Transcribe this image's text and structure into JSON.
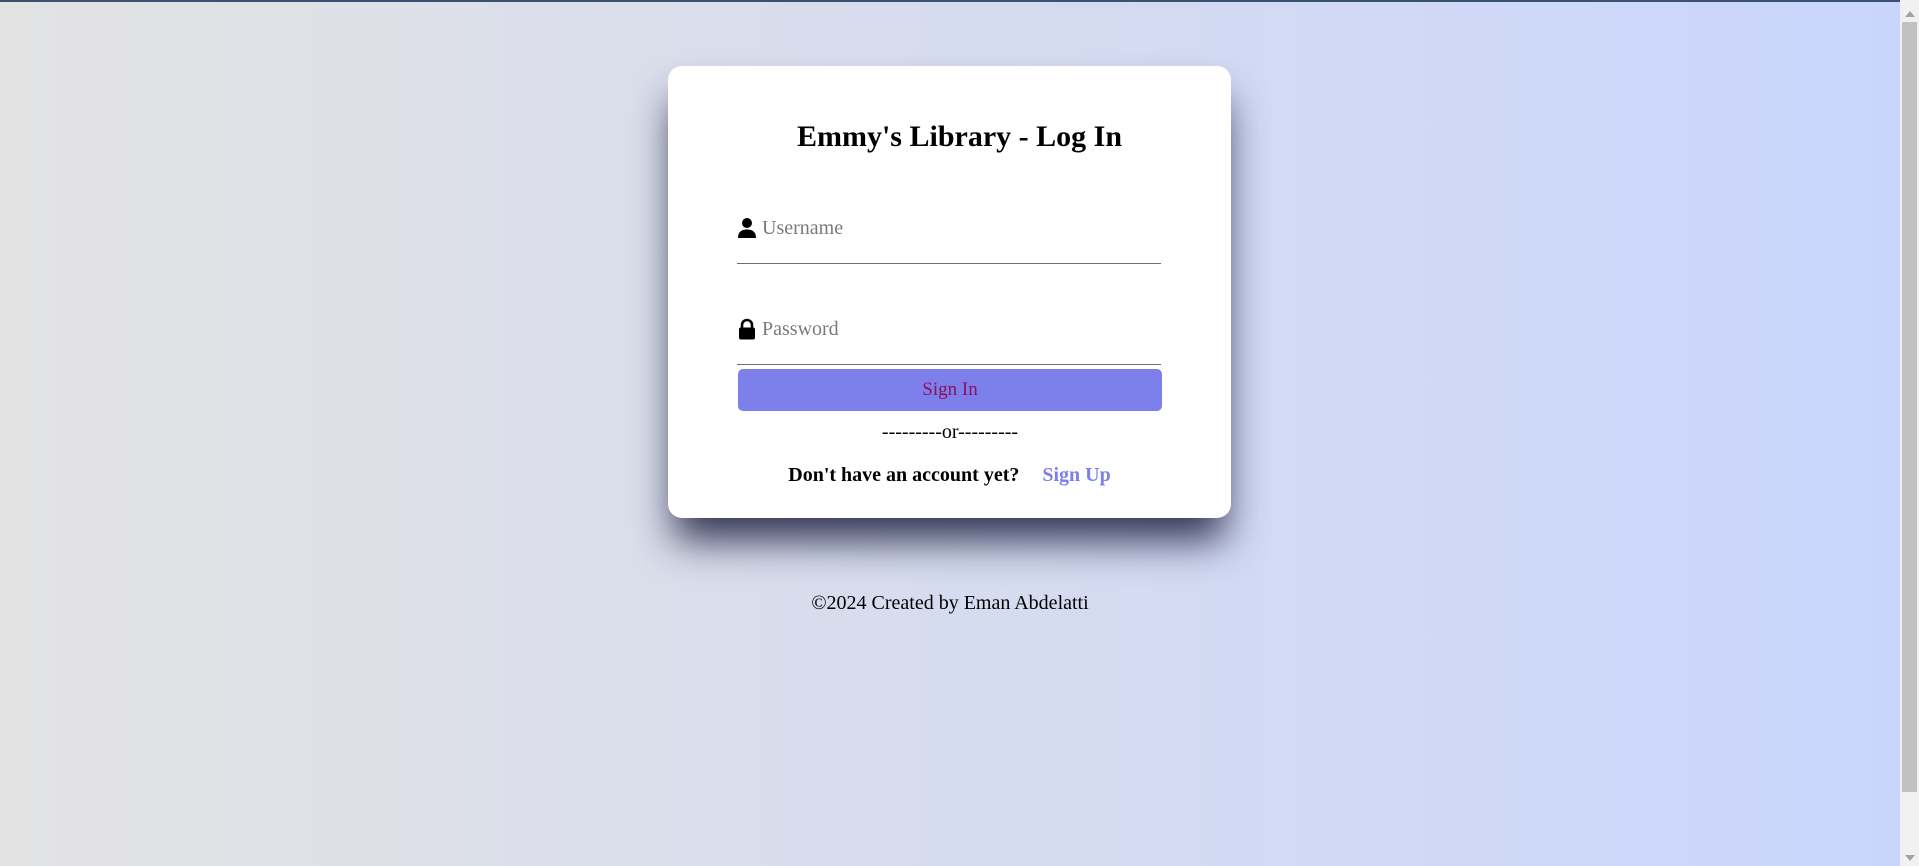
{
  "login_card": {
    "title": "Emmy's Library - Log In",
    "username": {
      "icon": "user-icon",
      "placeholder": "Username",
      "value": ""
    },
    "password": {
      "icon": "lock-icon",
      "placeholder": "Password",
      "value": ""
    },
    "sign_in_label": "Sign In",
    "divider_text": "---------or---------",
    "signup_prompt": "Don't have an account yet?",
    "signup_link_label": "Sign Up"
  },
  "footer": {
    "text": "©2024 Created by Eman Abdelatti"
  },
  "colors": {
    "accent": "#7d7fea",
    "sign_in_text": "#8d0f5b",
    "card_background": "#ffffff",
    "page_gradient_start": "#e3e3e3",
    "page_gradient_end": "#c9d5fd"
  }
}
